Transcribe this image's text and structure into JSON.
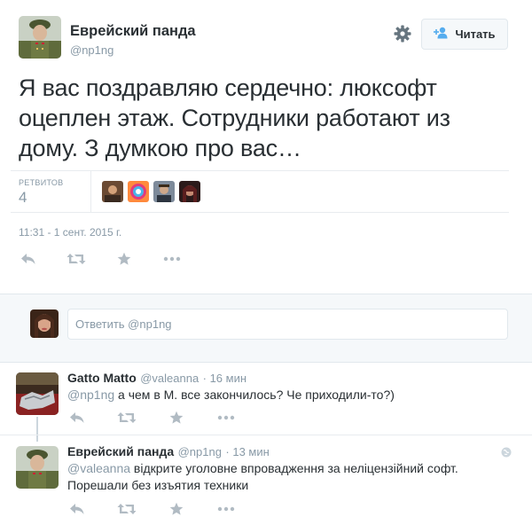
{
  "tweet": {
    "author_name": "Еврейский панда",
    "author_handle": "@np1ng",
    "follow_label": "Читать",
    "text": "Я вас поздравляю сердечно: люксофт оцеплен этаж. Сотрудники работают из дому. З думкою про вас…",
    "retweets_label": "РЕТВИТОВ",
    "retweets_count": "4",
    "timestamp": "11:31 - 1 сент. 2015 г."
  },
  "reply_box": {
    "placeholder": "Ответить @np1ng"
  },
  "replies": [
    {
      "name": "Gatto Matto",
      "handle": "@valeanna",
      "time": "· 16 мин",
      "mention": "@np1ng",
      "text": " а чем в М. все закончилось? Че приходили-то?)"
    },
    {
      "name": "Еврейский панда",
      "handle": "@np1ng",
      "time": "· 13 мин",
      "mention": "@valeanna",
      "text": " відкрите уголовне впровадження за неліцензійний софт. Порешали без изъятия техники"
    }
  ],
  "colors": {
    "text": "#292f33",
    "muted": "#8899a6",
    "accent": "#55acee",
    "border": "#e1e8ed"
  },
  "icons": [
    "gear-icon",
    "follow-user-icon",
    "reply-icon",
    "retweet-icon",
    "favorite-icon",
    "more-icon"
  ]
}
